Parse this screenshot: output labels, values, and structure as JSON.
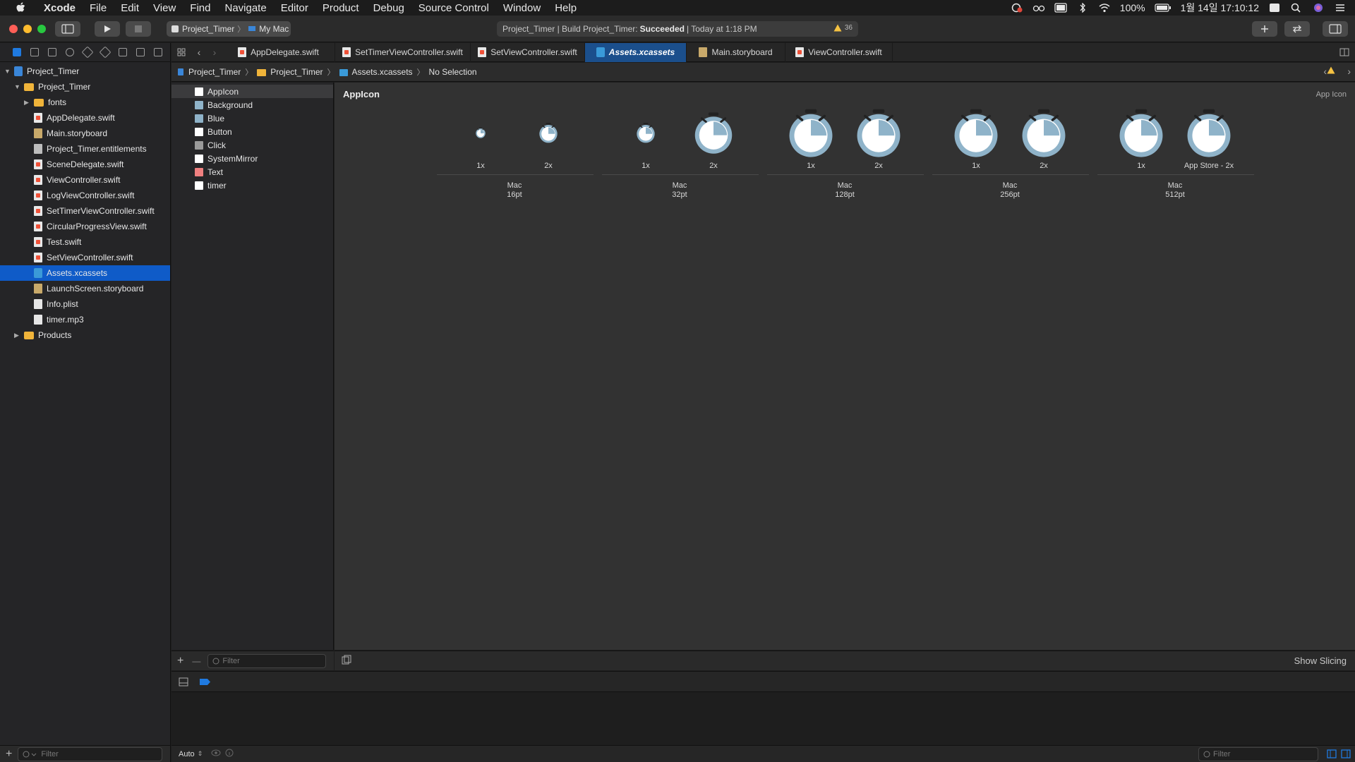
{
  "menubar": {
    "app_name": "Xcode",
    "items": [
      "File",
      "Edit",
      "View",
      "Find",
      "Navigate",
      "Editor",
      "Product",
      "Debug",
      "Source Control",
      "Window",
      "Help"
    ],
    "battery": "100%",
    "datetime": "1월 14일  17:10:12"
  },
  "toolbar": {
    "scheme_name": "Project_Timer",
    "destination": "My Mac",
    "activity_prefix": "Project_Timer | Build Project_Timer:",
    "activity_status": "Succeeded",
    "activity_time": "| Today at 1:18 PM",
    "warning_count": "36"
  },
  "navigator": {
    "rows": [
      {
        "label": "Project_Timer",
        "type": "proj",
        "disclosure": "▼"
      },
      {
        "label": "Project_Timer",
        "type": "folder",
        "disclosure": "▼"
      },
      {
        "label": "fonts",
        "type": "folder",
        "disclosure": "▶"
      },
      {
        "label": "AppDelegate.swift",
        "type": "swift",
        "disclosure": ""
      },
      {
        "label": "Main.storyboard",
        "type": "storyboard",
        "disclosure": ""
      },
      {
        "label": "Project_Timer.entitlements",
        "type": "ent",
        "disclosure": ""
      },
      {
        "label": "SceneDelegate.swift",
        "type": "swift",
        "disclosure": ""
      },
      {
        "label": "ViewController.swift",
        "type": "swift",
        "disclosure": ""
      },
      {
        "label": "LogViewController.swift",
        "type": "swift",
        "disclosure": ""
      },
      {
        "label": "SetTimerViewController.swift",
        "type": "swift",
        "disclosure": ""
      },
      {
        "label": "CircularProgressView.swift",
        "type": "swift",
        "disclosure": ""
      },
      {
        "label": "Test.swift",
        "type": "swift",
        "disclosure": ""
      },
      {
        "label": "SetViewController.swift",
        "type": "swift",
        "disclosure": ""
      },
      {
        "label": "Assets.xcassets",
        "type": "assets",
        "disclosure": "",
        "selected": true
      },
      {
        "label": "LaunchScreen.storyboard",
        "type": "storyboard",
        "disclosure": ""
      },
      {
        "label": "Info.plist",
        "type": "doc",
        "disclosure": ""
      },
      {
        "label": "timer.mp3",
        "type": "doc",
        "disclosure": ""
      },
      {
        "label": "Products",
        "type": "folder",
        "disclosure": "▶"
      }
    ],
    "filter_placeholder": "Filter"
  },
  "tabs": [
    {
      "label": "AppDelegate.swift",
      "active": false
    },
    {
      "label": "SetTimerViewController.swift",
      "active": false
    },
    {
      "label": "SetViewController.swift",
      "active": false
    },
    {
      "label": "Assets.xcassets",
      "active": true
    },
    {
      "label": "Main.storyboard",
      "active": false
    },
    {
      "label": "ViewController.swift",
      "active": false
    }
  ],
  "jumpbar": {
    "items": [
      "Project_Timer",
      "Project_Timer",
      "Assets.xcassets",
      "No Selection"
    ]
  },
  "assets": [
    {
      "label": "AppIcon",
      "color": "#ffffff",
      "selected": true
    },
    {
      "label": "Background",
      "color": "#8fb3c9"
    },
    {
      "label": "Blue",
      "color": "#8fb3c9"
    },
    {
      "label": "Button",
      "color": "#ffffff"
    },
    {
      "label": "Click",
      "color": "#9a9a9a"
    },
    {
      "label": "SystemMirror",
      "color": "#ffffff"
    },
    {
      "label": "Text",
      "color": "#f08080"
    },
    {
      "label": "timer",
      "color": "#ffffff"
    }
  ],
  "detail": {
    "title": "AppIcon",
    "kind": "App Icon",
    "slots": [
      "1x",
      "2x",
      "1x",
      "2x",
      "1x",
      "2x",
      "1x",
      "2x",
      "1x",
      "App Store - 2x"
    ],
    "groups": [
      {
        "platform": "Mac",
        "size": "16pt"
      },
      {
        "platform": "Mac",
        "size": "32pt"
      },
      {
        "platform": "Mac",
        "size": "128pt"
      },
      {
        "platform": "Mac",
        "size": "256pt"
      },
      {
        "platform": "Mac",
        "size": "512pt"
      }
    ],
    "show_slicing": "Show Slicing"
  },
  "list_footer": {
    "add": "+",
    "remove": "—",
    "filter_placeholder": "Filter"
  },
  "console_footer": {
    "mode": "Auto",
    "filter_placeholder": "Filter"
  },
  "colors": {
    "accent": "#0f5bc8",
    "icon_ring": "#8fb3c9",
    "warning": "#f5c242"
  }
}
